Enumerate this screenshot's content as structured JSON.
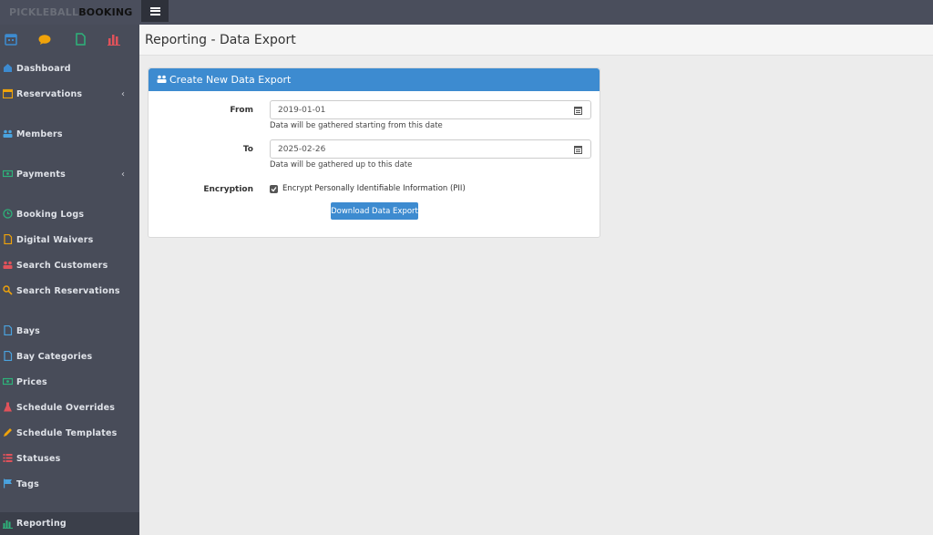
{
  "brand": {
    "part1": "PICKLEBALL",
    "part2": "BOOKING"
  },
  "quick_icons": [
    {
      "icon": "calendar-icon",
      "color": "#3d8bd0"
    },
    {
      "icon": "chat-bubble-icon",
      "color": "#f0a30a"
    },
    {
      "icon": "document-icon",
      "color": "#2db37a"
    },
    {
      "icon": "bar-chart-icon",
      "color": "#e0525a"
    }
  ],
  "sidebar": {
    "items": [
      {
        "label": "Dashboard",
        "icon": "home-icon",
        "color": "#3d8bd0"
      },
      {
        "label": "Reservations",
        "icon": "calendar-icon",
        "color": "#f0a30a",
        "chevron": "‹"
      },
      {
        "label": "Members",
        "icon": "users-icon",
        "color": "#4aa3df"
      },
      {
        "label": "Payments",
        "icon": "money-icon",
        "color": "#2db37a",
        "chevron": "‹"
      },
      {
        "label": "Booking Logs",
        "icon": "clock-icon",
        "color": "#2db37a"
      },
      {
        "label": "Digital Waivers",
        "icon": "file-icon",
        "color": "#f0a30a"
      },
      {
        "label": "Search Customers",
        "icon": "users-icon",
        "color": "#e0525a"
      },
      {
        "label": "Search Reservations",
        "icon": "search-icon",
        "color": "#f0a30a"
      },
      {
        "label": "Bays",
        "icon": "file-icon",
        "color": "#4aa3df"
      },
      {
        "label": "Bay Categories",
        "icon": "file-icon",
        "color": "#4aa3df"
      },
      {
        "label": "Prices",
        "icon": "money-icon",
        "color": "#2db37a"
      },
      {
        "label": "Schedule Overrides",
        "icon": "flask-icon",
        "color": "#e0525a"
      },
      {
        "label": "Schedule Templates",
        "icon": "pencil-icon",
        "color": "#f0a30a"
      },
      {
        "label": "Statuses",
        "icon": "list-icon",
        "color": "#e0525a"
      },
      {
        "label": "Tags",
        "icon": "flag-icon",
        "color": "#4aa3df"
      },
      {
        "label": "Reporting",
        "icon": "bar-chart-icon",
        "color": "#2db37a",
        "active": true
      }
    ]
  },
  "page": {
    "title": "Reporting - Data Export"
  },
  "card": {
    "title": "Create New Data Export",
    "from_label": "From",
    "from_value": "2019-01-01",
    "from_help": "Data will be gathered starting from this date",
    "to_label": "To",
    "to_value": "2025-02-26",
    "to_help": "Data will be gathered up to this date",
    "encryption_label": "Encryption",
    "encryption_checkbox_label": "Encrypt Personally Identifiable Information (PII)",
    "encryption_checked": true,
    "button_label": "Download Data Export"
  },
  "colors": {
    "accent": "#3d8bd0",
    "sidebar": "#484c59",
    "topbar": "#4a4e5c"
  }
}
